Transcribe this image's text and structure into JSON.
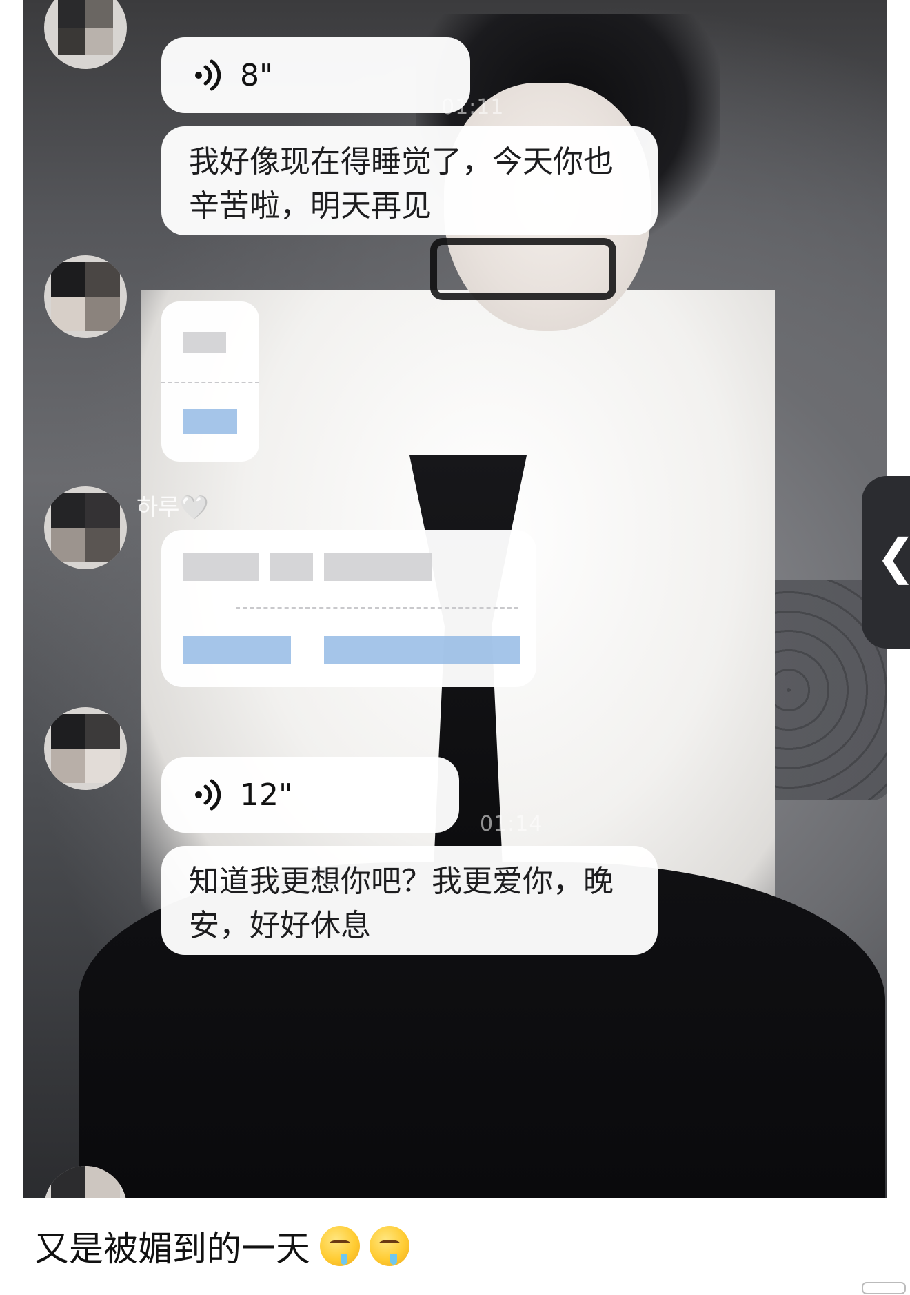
{
  "messages": {
    "voice1": {
      "duration": "8\""
    },
    "time1": "01:11",
    "text1": "我好像现在得睡觉了，今天你也辛苦啦，明天再见",
    "sender_name": "하루🤍",
    "voice2": {
      "duration": "12\""
    },
    "time2": "01:14",
    "text2": "知道我更想你吧？我更爱你，晚安，好好休息"
  },
  "side_handle": {
    "glyph": "❮"
  },
  "caption": {
    "text": "又是被媚到的一天"
  },
  "icons": {
    "voice": "voice-wave-icon",
    "emoji": "drooling-face-emoji",
    "chevron": "chevron-left-icon"
  },
  "colors": {
    "bubble": "#ffffff",
    "blur_blue": "#8fb6e3",
    "caption_text": "#111111"
  }
}
